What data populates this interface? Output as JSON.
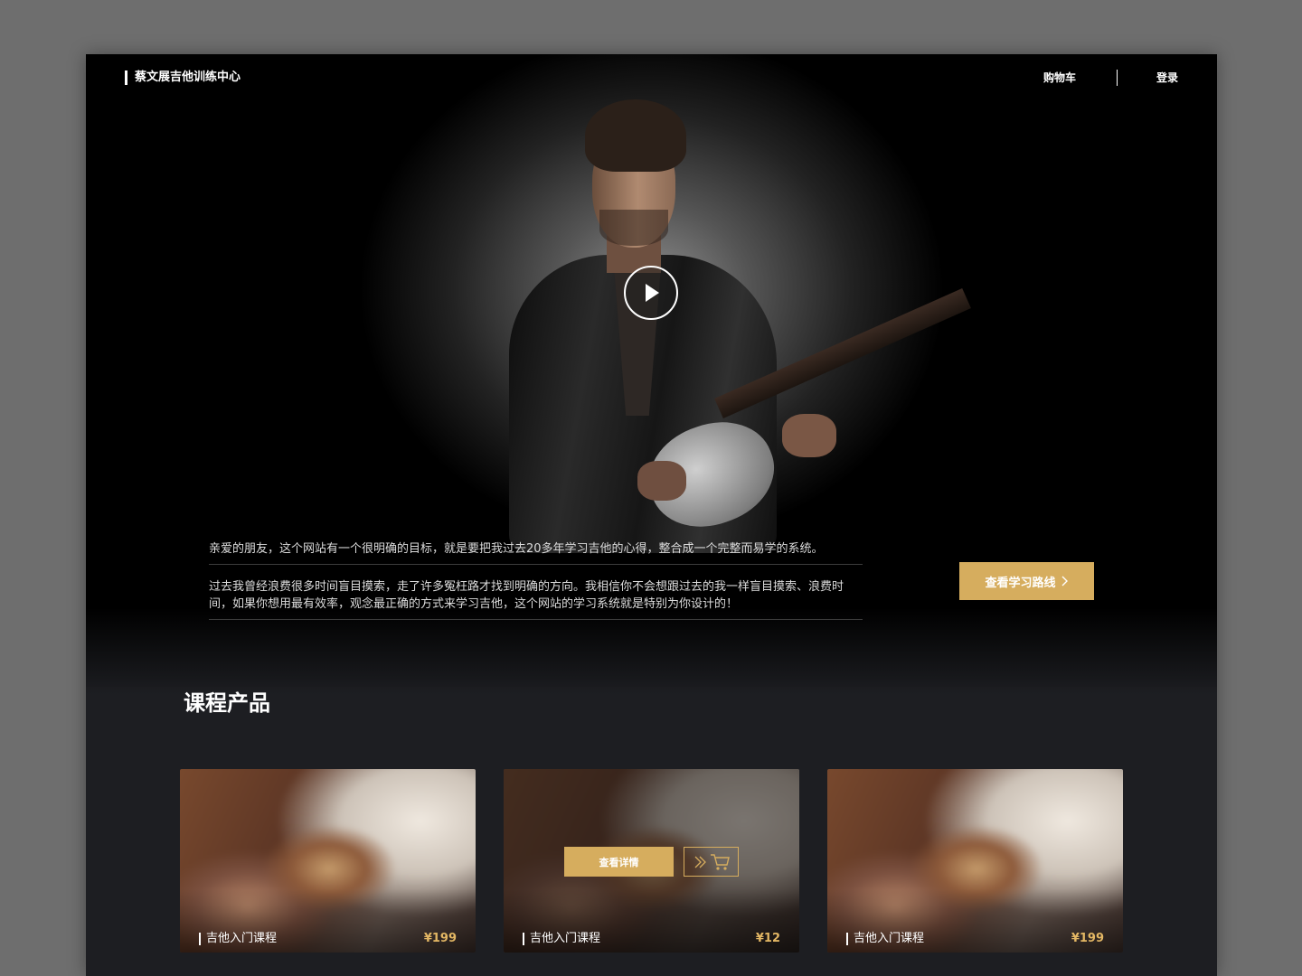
{
  "header": {
    "logo_text": "蔡文展吉他训练中心",
    "cart_label": "购物车",
    "login_label": "登录"
  },
  "hero": {
    "play_icon": "play-icon",
    "intro_paragraph_1": "亲爱的朋友，这个网站有一个很明确的目标，就是要把我过去20多年学习吉他的心得，整合成一个完整而易学的系统。",
    "intro_paragraph_2": "过去我曾经浪费很多时间盲目摸索，走了许多冤枉路才找到明确的方向。我相信你不会想跟过去的我一样盲目摸索、浪费时间，如果你想用最有效率，观念最正确的方式来学习吉他，这个网站的学习系统就是特别为你设计的！",
    "route_button_label": "查看学习路线",
    "route_button_icon": "chevron-right-icon"
  },
  "courses": {
    "section_title": "课程产品",
    "items": [
      {
        "name": "吉他入门课程",
        "price": "¥199"
      },
      {
        "name": "吉他入门课程",
        "price": "¥12",
        "detail_label": "查看详情",
        "cart_icon": "add-to-cart-icon"
      },
      {
        "name": "吉他入门课程",
        "price": "¥199"
      }
    ]
  },
  "colors": {
    "accent": "#d6ad5e",
    "price": "#e3b764",
    "page_background": "#1d1e22"
  }
}
